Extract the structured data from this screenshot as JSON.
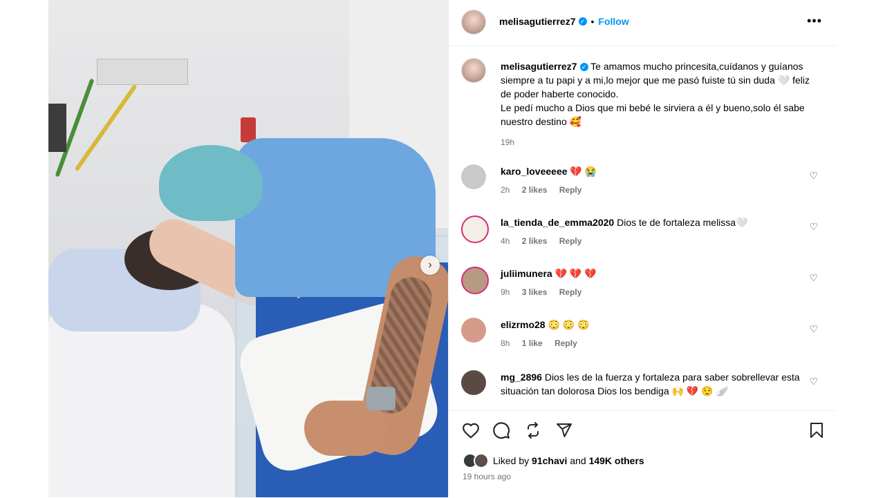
{
  "post": {
    "username": "melisagutierrez7",
    "follow_label": "Follow",
    "more_label": "•••",
    "separator": "•",
    "caption_line1": "Te amamos mucho princesita,cuídanos y guíanos siempre a tu papi y a mi,lo mejor que me pasó fuiste tú sin duda 🤍  feliz de poder haberte conocido.",
    "caption_line2": "Le pedí mucho a Dios que mi bebé le sirviera a él y bueno,solo él sabe nuestro destino 🥰",
    "caption_time": "19h",
    "photo_overlay_emoji": "🤍",
    "next_icon": "›"
  },
  "comments": [
    {
      "user": "karo_loveeeee",
      "text": "💔 😭",
      "time": "2h",
      "likes": "2 likes",
      "reply": "Reply"
    },
    {
      "user": "la_tienda_de_emma2020",
      "text": "Dios te de fortaleza melissa🤍",
      "time": "4h",
      "likes": "2 likes",
      "reply": "Reply"
    },
    {
      "user": "juliimunera",
      "text": "💔 💔 💔",
      "time": "9h",
      "likes": "3 likes",
      "reply": "Reply"
    },
    {
      "user": "elizrmo28",
      "text": "😳 😳 😳",
      "time": "8h",
      "likes": "1 like",
      "reply": "Reply"
    },
    {
      "user": "mg_2896",
      "text": "Dios les de la fuerza y fortaleza para saber sobrellevar esta situación tan dolorosa Dios los bendiga 🙌 💔 😌 🪽",
      "time": "",
      "likes": "",
      "reply": ""
    }
  ],
  "actions": {
    "liked_by_prefix": "Liked by",
    "liked_by_user": "91chavi",
    "liked_by_mid": "and",
    "liked_by_count": "149K others",
    "time_ago": "19 hours ago"
  },
  "colors": {
    "accent": "#0095f6",
    "meta_text": "#737373",
    "heart": "#e0245e"
  },
  "icons": [
    "heart-icon",
    "comment-icon",
    "share-icon",
    "send-icon",
    "bookmark-icon",
    "more-icon",
    "verified-badge-icon",
    "chevron-right-icon"
  ]
}
